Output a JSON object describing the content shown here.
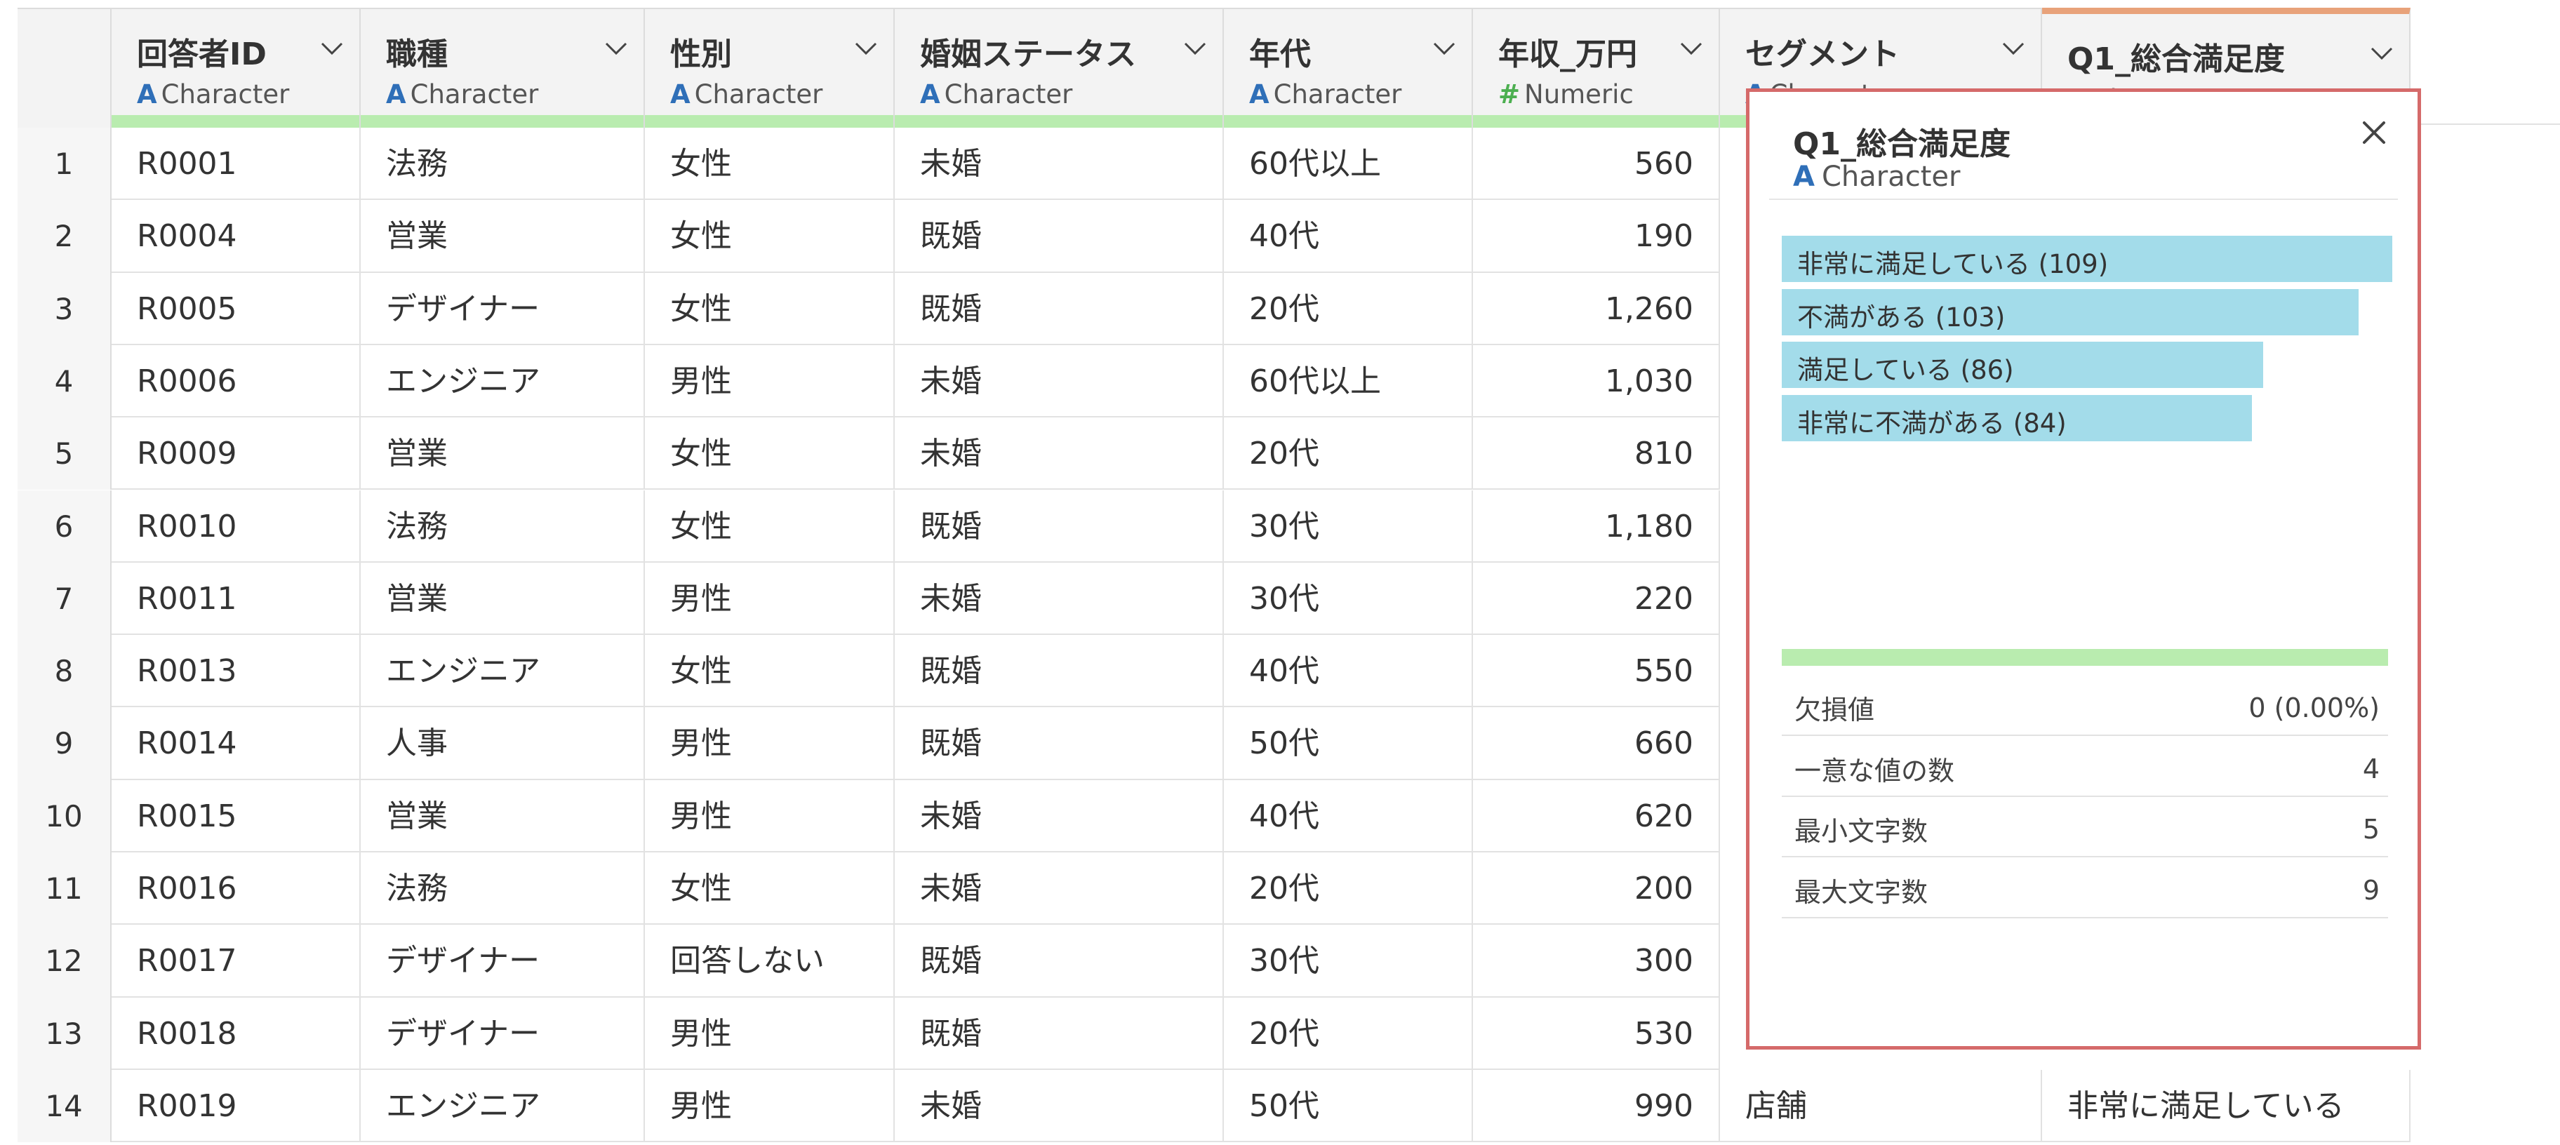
{
  "colors": {
    "header_bg": "#f3f3f3",
    "quality_bar": "#b9ecaf",
    "selected_accent": "#e8a27a",
    "panel_border": "#d56a6a",
    "freq_bar": "#a3dcea",
    "character_icon": "#2f6fb8",
    "numeric_icon": "#4caf50"
  },
  "columns": [
    {
      "name": "回答者ID",
      "type_icon": "A",
      "type": "Character"
    },
    {
      "name": "職種",
      "type_icon": "A",
      "type": "Character"
    },
    {
      "name": "性別",
      "type_icon": "A",
      "type": "Character"
    },
    {
      "name": "婚姻ステータス",
      "type_icon": "A",
      "type": "Character"
    },
    {
      "name": "年代",
      "type_icon": "A",
      "type": "Character"
    },
    {
      "name": "年収_万円",
      "type_icon": "#",
      "type": "Numeric"
    },
    {
      "name": "セグメント",
      "type_icon": "A",
      "type": "Character"
    },
    {
      "name": "Q1_総合満足度",
      "type_icon": "A",
      "type": "Character"
    }
  ],
  "rows": [
    {
      "n": "1",
      "cells": [
        "R0001",
        "法務",
        "女性",
        "未婚",
        "60代以上",
        "560"
      ]
    },
    {
      "n": "2",
      "cells": [
        "R0004",
        "営業",
        "女性",
        "既婚",
        "40代",
        "190"
      ]
    },
    {
      "n": "3",
      "cells": [
        "R0005",
        "デザイナー",
        "女性",
        "既婚",
        "20代",
        "1,260"
      ]
    },
    {
      "n": "4",
      "cells": [
        "R0006",
        "エンジニア",
        "男性",
        "未婚",
        "60代以上",
        "1,030"
      ]
    },
    {
      "n": "5",
      "cells": [
        "R0009",
        "営業",
        "女性",
        "未婚",
        "20代",
        "810"
      ]
    },
    {
      "n": "6",
      "cells": [
        "R0010",
        "法務",
        "女性",
        "既婚",
        "30代",
        "1,180"
      ]
    },
    {
      "n": "7",
      "cells": [
        "R0011",
        "営業",
        "男性",
        "未婚",
        "30代",
        "220"
      ]
    },
    {
      "n": "8",
      "cells": [
        "R0013",
        "エンジニア",
        "女性",
        "既婚",
        "40代",
        "550"
      ]
    },
    {
      "n": "9",
      "cells": [
        "R0014",
        "人事",
        "男性",
        "既婚",
        "50代",
        "660"
      ]
    },
    {
      "n": "10",
      "cells": [
        "R0015",
        "営業",
        "男性",
        "未婚",
        "40代",
        "620"
      ]
    },
    {
      "n": "11",
      "cells": [
        "R0016",
        "法務",
        "女性",
        "未婚",
        "20代",
        "200"
      ]
    },
    {
      "n": "12",
      "cells": [
        "R0017",
        "デザイナー",
        "回答しない",
        "既婚",
        "30代",
        "300"
      ]
    },
    {
      "n": "13",
      "cells": [
        "R0018",
        "デザイナー",
        "男性",
        "既婚",
        "20代",
        "530"
      ]
    },
    {
      "n": "14",
      "cells": [
        "R0019",
        "エンジニア",
        "男性",
        "未婚",
        "50代",
        "990",
        "店舗",
        "非常に満足している"
      ]
    }
  ],
  "panel": {
    "title": "Q1_総合満足度",
    "type_icon": "A",
    "type": "Character",
    "frequencies": [
      {
        "label": "非常に満足している (109)",
        "count": 109
      },
      {
        "label": "不満がある (103)",
        "count": 103
      },
      {
        "label": "満足している (86)",
        "count": 86
      },
      {
        "label": "非常に不満がある (84)",
        "count": 84
      }
    ],
    "stats": [
      {
        "label": "欠損値",
        "value": "0 (0.00%)"
      },
      {
        "label": "一意な値の数",
        "value": "4"
      },
      {
        "label": "最小文字数",
        "value": "5"
      },
      {
        "label": "最大文字数",
        "value": "9"
      }
    ]
  }
}
